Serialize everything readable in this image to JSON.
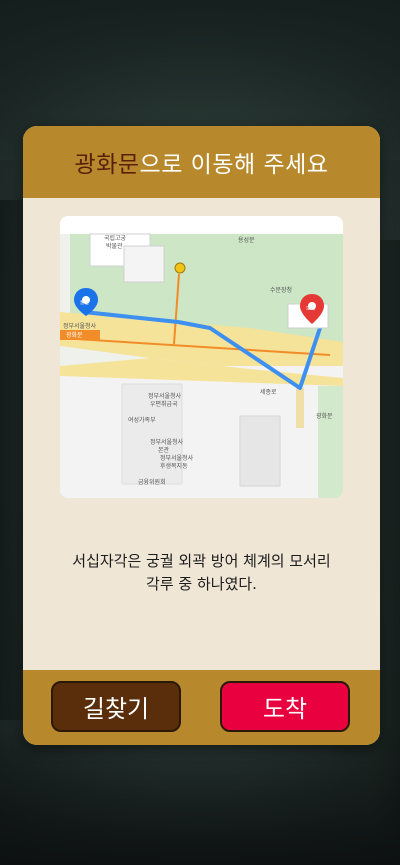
{
  "dialog": {
    "title_highlight": "광화문",
    "title_rest": "으로 이동해 주세요",
    "description_line1": "서십자각은 궁궐 외곽 방어 체계의 모서리",
    "description_line2": "각루 중 하나였다."
  },
  "map": {
    "start_marker": "출발",
    "end_marker": "도착",
    "labels": {
      "museum_1": "국립고궁",
      "museum_2": "박물관",
      "yongseongjeon": "용성문",
      "sujeongjeon": "수문장청",
      "gwanghwamun_station_1": "정부서울청사",
      "gwanghwamun_station_2": "광화문",
      "gov_bldg_1": "정부서울청사",
      "gov_bldg_2": "우편취급국",
      "yeoseong": "여성가족부",
      "gov_annex_1": "정부서울청사",
      "gov_annex_2": "본관",
      "gov_rear_1": "정부서울청사",
      "gov_rear_2": "후생복지동",
      "fin_1": "정부서울청사",
      "fin_2": "후생복지동",
      "fin_com": "금융위원회",
      "sejongno": "세종로",
      "gwanghwamun_right": "광화문",
      "bus_icon": "S"
    }
  },
  "buttons": {
    "find_way": "길찾기",
    "arrive": "도착"
  },
  "colors": {
    "header": "#b8892c",
    "title_highlight": "#5a1e0a",
    "dialog_bg": "#efe6d6",
    "find_button": "#5a2e0a",
    "arrive_button": "#e8003f",
    "route": "#3d8ff0",
    "start_pin": "#1a73e8",
    "end_pin": "#e53935"
  }
}
